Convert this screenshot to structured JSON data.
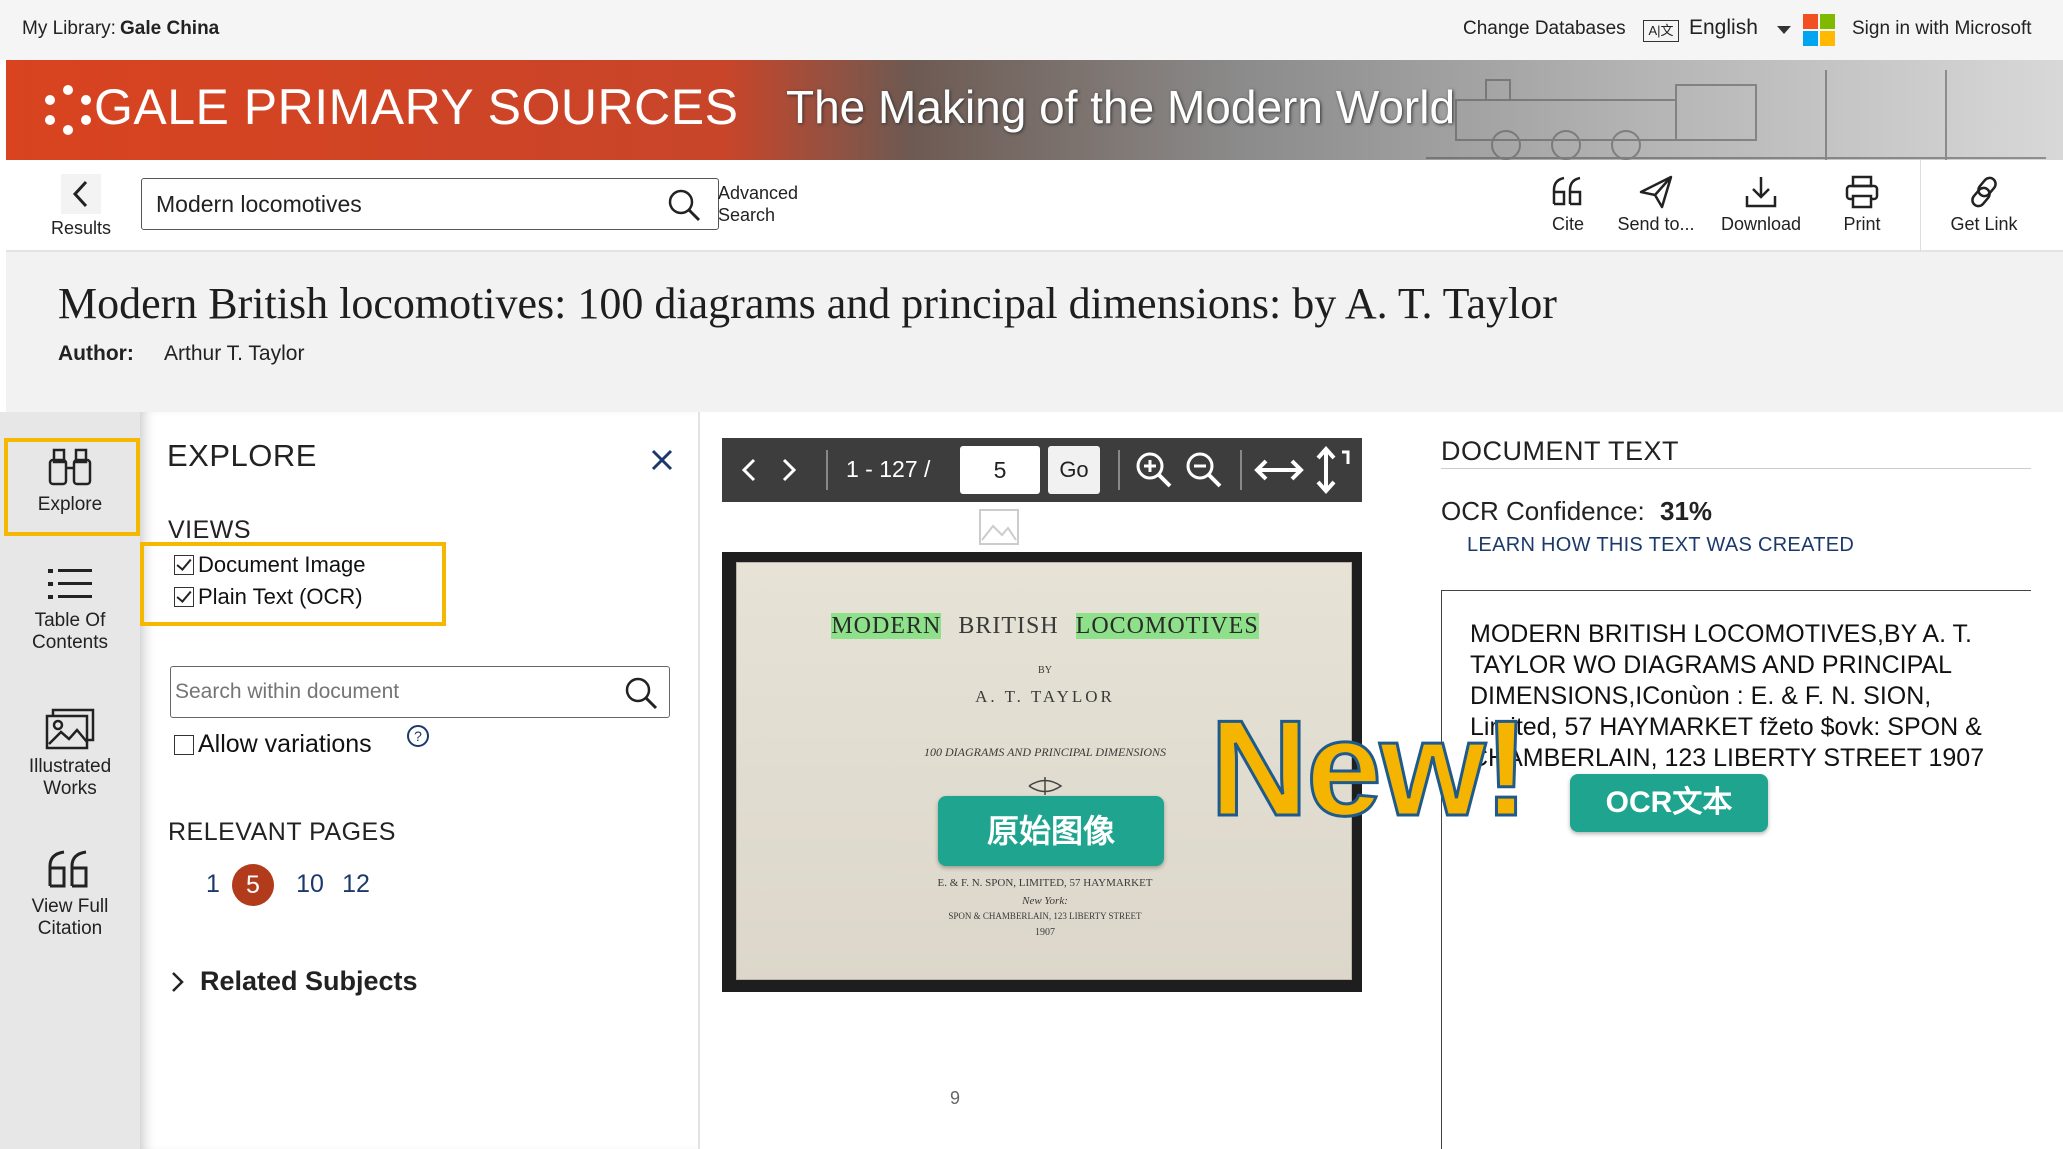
{
  "topbar": {
    "library_label": "My Library:",
    "library_name": "Gale China",
    "change_databases": "Change Databases",
    "language": "English",
    "sign_in": "Sign in with Microsoft"
  },
  "banner": {
    "brand": "GALE PRIMARY SOURCES",
    "collection": "The Making of the Modern World"
  },
  "toolbar": {
    "results_label": "Results",
    "search_value": "Modern locomotives",
    "advanced_line1": "Advanced",
    "advanced_line2": "Search",
    "cite": "Cite",
    "send_to": "Send to...",
    "download": "Download",
    "print": "Print",
    "get_link": "Get Link"
  },
  "document": {
    "title": "Modern British locomotives: 100 diagrams and principal dimensions: by A. T. Taylor",
    "author_label": "Author:",
    "author_name": "Arthur T. Taylor"
  },
  "rail": {
    "explore": "Explore",
    "toc_line1": "Table Of",
    "toc_line2": "Contents",
    "illustrated_line1": "Illustrated",
    "illustrated_line2": "Works",
    "citation_line1": "View Full",
    "citation_line2": "Citation"
  },
  "explore": {
    "heading": "EXPLORE",
    "views_heading": "VIEWS",
    "view_image": "Document Image",
    "view_text": "Plain Text (OCR)",
    "search_placeholder": "Search within document",
    "allow_variations": "Allow variations",
    "relevant_heading": "RELEVANT PAGES",
    "relevant_pages": [
      "1",
      "5",
      "10",
      "12"
    ],
    "current_page": "5",
    "related_subjects": "Related Subjects"
  },
  "viewer": {
    "page_range": "1 - 127 /",
    "page_input": "5",
    "go": "Go",
    "scan_footer": "9",
    "scan_title_1": "MODERN",
    "scan_title_2": "BRITISH",
    "scan_title_3": "LOCOMOTIVES",
    "scan_by": "BY",
    "scan_author": "A. T. TAYLOR",
    "scan_subtitle": "100 DIAGRAMS AND PRINCIPAL DIMENSIONS",
    "scan_pub1": "E. & F. N. SPON, LIMITED, 57 HAYMARKET",
    "scan_pub2": "New York:",
    "scan_pub3": "SPON & CHAMBERLAIN, 123 LIBERTY STREET",
    "scan_year": "1907"
  },
  "doctext": {
    "heading": "DOCUMENT TEXT",
    "ocr_label": "OCR Confidence:",
    "ocr_value": "31%",
    "learn_link": "LEARN HOW THIS TEXT WAS CREATED",
    "ocr_body": "MODERN BRITISH LOCOMOTIVES,BY A. T. TAYLOR WO DIAGRAMS AND PRINCIPAL DIMENSIONS,IConùon : E. & F. N. SION, Limited, 57 HAYMARKET fžeto $ovk: SPON & CHAMBERLAIN, 123 LIBERTY STREET 1907"
  },
  "annotations": {
    "new_badge": "New!",
    "image_pill": "原始图像",
    "ocr_pill": "OCR文本"
  },
  "colors": {
    "brand_red": "#d9431f",
    "highlight": "#f5b800",
    "pill_teal": "#1fa58f",
    "current_page": "#b23b1c"
  }
}
